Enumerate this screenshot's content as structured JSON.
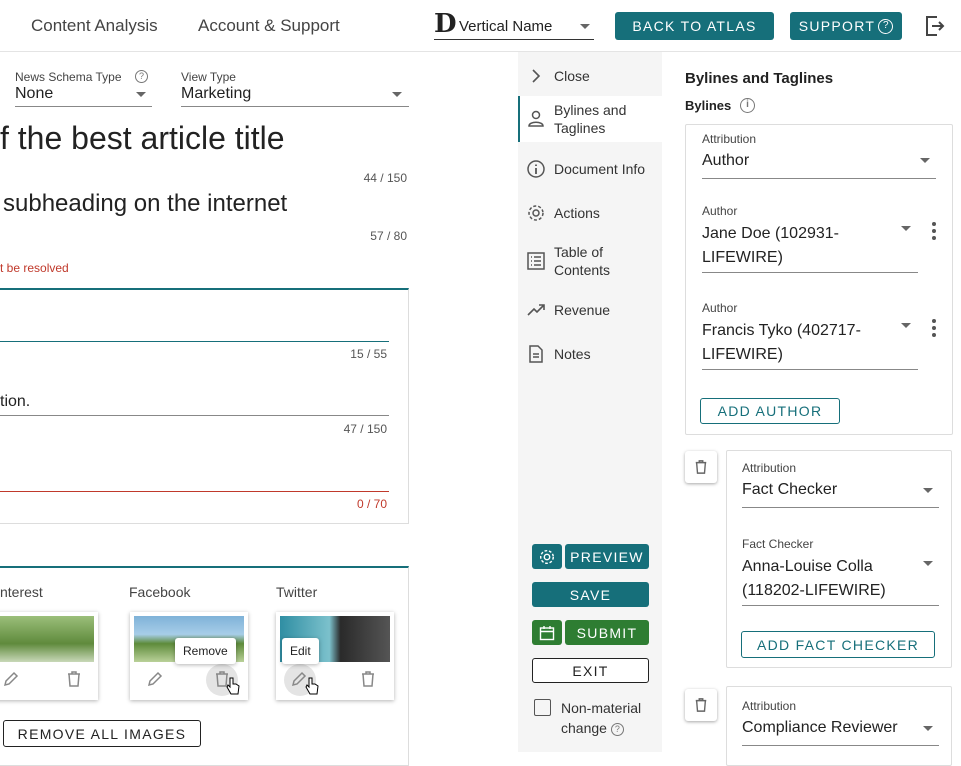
{
  "topbar": {
    "nav": [
      "Content Analysis",
      "Account & Support"
    ],
    "vertical_logo": "D",
    "vertical_name": "Vertical Name",
    "back_label": "BACK TO ATLAS",
    "support_label": "SUPPORT",
    "support_icon": "?"
  },
  "editor": {
    "news_schema_label": "News Schema Type",
    "news_schema_value": "None",
    "view_type_label": "View Type",
    "view_type_value": "Marketing",
    "title": "f the best article title",
    "title_counter": "44 / 150",
    "subheading": "subheading on the internet",
    "sub_counter": "57 / 80",
    "error_text": "t be resolved",
    "field1_counter": "15 / 55",
    "field2_text": "tion.",
    "field2_counter": "47 / 150",
    "field3_counter": "0 / 70"
  },
  "images": {
    "labels": [
      "nterest",
      "Facebook",
      "Twitter"
    ],
    "remove_tooltip": "Remove",
    "edit_tooltip": "Edit",
    "remove_all": "REMOVE ALL IMAGES"
  },
  "midnav": {
    "close": "Close",
    "items": [
      "Bylines and Taglines",
      "Document Info",
      "Actions",
      "Table of Contents",
      "Revenue",
      "Notes"
    ],
    "preview": "PREVIEW",
    "save": "SAVE",
    "submit": "SUBMIT",
    "exit": "EXIT",
    "nonmaterial": "Non-material change"
  },
  "bylines": {
    "heading": "Bylines and Taglines",
    "sub_heading": "Bylines",
    "attribution_label": "Attribution",
    "attribution_value": "Author",
    "author_label": "Author",
    "author1": "Jane Doe (102931-LIFEWIRE)",
    "author2": "Francis Tyko (402717-LIFEWIRE)",
    "add_author": "ADD AUTHOR",
    "fc_attribution_value": "Fact Checker",
    "fc_label": "Fact Checker",
    "fc_value": "Anna-Louise Colla (118202-LIFEWIRE)",
    "add_fc": "ADD FACT CHECKER",
    "cr_attribution_value": "Compliance Reviewer"
  },
  "colors": {
    "accent": "#166f7a",
    "submit_green": "#2e7d32",
    "error": "#c0392b"
  }
}
